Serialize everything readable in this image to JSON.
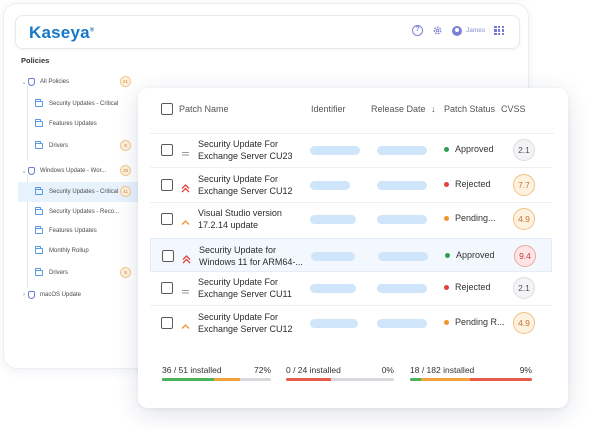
{
  "app": {
    "logo": "Kaseya",
    "logo_mark": "®",
    "help_icon": "?",
    "user_name": "James",
    "section_title": "Policies",
    "tree": [
      {
        "label": "All Policies",
        "count": "21"
      },
      {
        "label": "Security Updates - Critical"
      },
      {
        "label": "Features Updates"
      },
      {
        "label": "Drivers",
        "count": "9"
      },
      {
        "label": "Windows Update - Wor...",
        "count": "29"
      },
      {
        "label": "Security Updates - Critical",
        "count": "41"
      },
      {
        "label": "Security Updates - Reco..."
      },
      {
        "label": "Features Updates"
      },
      {
        "label": "Monthly Rollup"
      },
      {
        "label": "Drivers",
        "count": "9"
      },
      {
        "label": "macOS Update"
      }
    ]
  },
  "table": {
    "columns": {
      "patch_name": "Patch Name",
      "identifier": "Identifier",
      "release_date": "Release Date",
      "sort_arrow": "↓",
      "patch_status": "Patch Status",
      "cvss": "CVSS"
    },
    "rows": [
      {
        "name_line1": "Security Update For",
        "name_line2": "Exchange Server CU23",
        "priority": "medium",
        "status": "Approved",
        "cvss": "2.1"
      },
      {
        "name_line1": "Security Update For",
        "name_line2": "Exchange Server CU12",
        "priority": "high",
        "status": "Rejected",
        "cvss": "7.7"
      },
      {
        "name_line1": "Visual Studio version",
        "name_line2": "17.2.14 update",
        "priority": "low",
        "status": "Pending...",
        "cvss": "4.9"
      },
      {
        "name_line1": "Security Update for",
        "name_line2": "Windows 11 for ARM64-...",
        "priority": "high",
        "status": "Approved",
        "cvss": "9.4"
      },
      {
        "name_line1": "Security Update For",
        "name_line2": "Exchange Server CU11",
        "priority": "medium",
        "status": "Rejected",
        "cvss": "2.1"
      },
      {
        "name_line1": "Security Update For",
        "name_line2": "Exchange Server CU12",
        "priority": "low",
        "status": "Pending R...",
        "cvss": "4.9"
      }
    ]
  },
  "footer": [
    {
      "label": "36 / 51 installed",
      "percent": "72%"
    },
    {
      "label": "0 / 24 installed",
      "percent": "0%"
    },
    {
      "label": "18 / 182 installed",
      "percent": "9%"
    }
  ],
  "colors": {
    "approved": "#2f9e4f",
    "rejected": "#e0413d",
    "pending": "#f0942b",
    "brand": "#1677c9"
  }
}
